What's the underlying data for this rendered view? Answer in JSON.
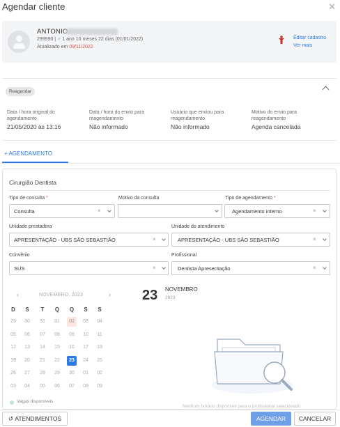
{
  "modal": {
    "title": "Agendar cliente",
    "close_icon": "close-icon"
  },
  "patient": {
    "name": "ANTONIO",
    "id_line_prefix": "299990 |",
    "gender_symbol": "♂",
    "id_line_suffix": "1 ano 10 meses 22 dias (01/01/2022)",
    "updated_prefix": "Atualizado em",
    "updated_date": "09/11/2022",
    "edit_link": "Editar cadastro",
    "more_link": "Ver mais"
  },
  "reschedule": {
    "badge": "Reagendar",
    "columns": [
      {
        "label": "Data / hora original do agendamento",
        "value": "21/05/2020 às 13:16"
      },
      {
        "label": "Data / hora do envio para reagendamento",
        "value": "Não informado"
      },
      {
        "label": "Usuário que enviou para reagendamento",
        "value": "Não informado"
      },
      {
        "label": "Motivo do envio para reagendamento",
        "value": "Agenda cancelada"
      }
    ]
  },
  "tab": {
    "label": "+ AGENDAMENTO"
  },
  "form": {
    "specialty": "Cirurgião Dentista",
    "tipo_consulta": {
      "label": "Tipo de consulta",
      "required": "*",
      "value": "Consulta"
    },
    "motivo": {
      "label": "Motivo da consulta",
      "value": ""
    },
    "tipo_agendamento": {
      "label": "Tipo de agendamento",
      "required": "*",
      "value": "Agendamento interno"
    },
    "unidade_prestadora": {
      "label": "Unidade prestadora",
      "value": "APRESENTAÇÃO - UBS SÃO SEBASTIÃO"
    },
    "unidade_atendimento": {
      "label": "Unidade do atendimento",
      "value": "APRESENTAÇÃO - UBS SÃO SEBASTIÃO"
    },
    "convenio": {
      "label": "Convênio",
      "value": "SUS"
    },
    "profissional": {
      "label": "Profissional",
      "value": "Dentista Apresentação"
    },
    "clear_symbol": "×"
  },
  "calendar": {
    "month_label": "NOVEMBRO, 2023",
    "prev": "‹",
    "next": "›",
    "weekdays": [
      "D",
      "S",
      "T",
      "Q",
      "Q",
      "S",
      "S"
    ],
    "days": [
      "29",
      "30",
      "31",
      "01",
      "02",
      "03",
      "04",
      "05",
      "06",
      "07",
      "08",
      "09",
      "10",
      "11",
      "12",
      "13",
      "14",
      "15",
      "16",
      "17",
      "18",
      "19",
      "20",
      "21",
      "22",
      "23",
      "24",
      "25",
      "26",
      "27",
      "28",
      "29",
      "30",
      "01",
      "02",
      "03",
      "04",
      "05",
      "06",
      "07",
      "08",
      "09"
    ],
    "today_index": 4,
    "selected_index": 25,
    "selected_day": "23",
    "selected_month": "NOVEMBRO",
    "selected_year": "2023",
    "legend": "Vagas disponíveis",
    "empty_hint": "Nenhum horário disponível para o profissional selecionado"
  },
  "footer": {
    "atendimentos": "ATENDIMENTOS",
    "atendimentos_icon": "↺",
    "agendar": "AGENDAR",
    "cancelar": "CANCELAR"
  },
  "colors": {
    "primary": "#2c7be5",
    "danger": "#d9534f",
    "disabled_primary": "#6f9fe6"
  }
}
